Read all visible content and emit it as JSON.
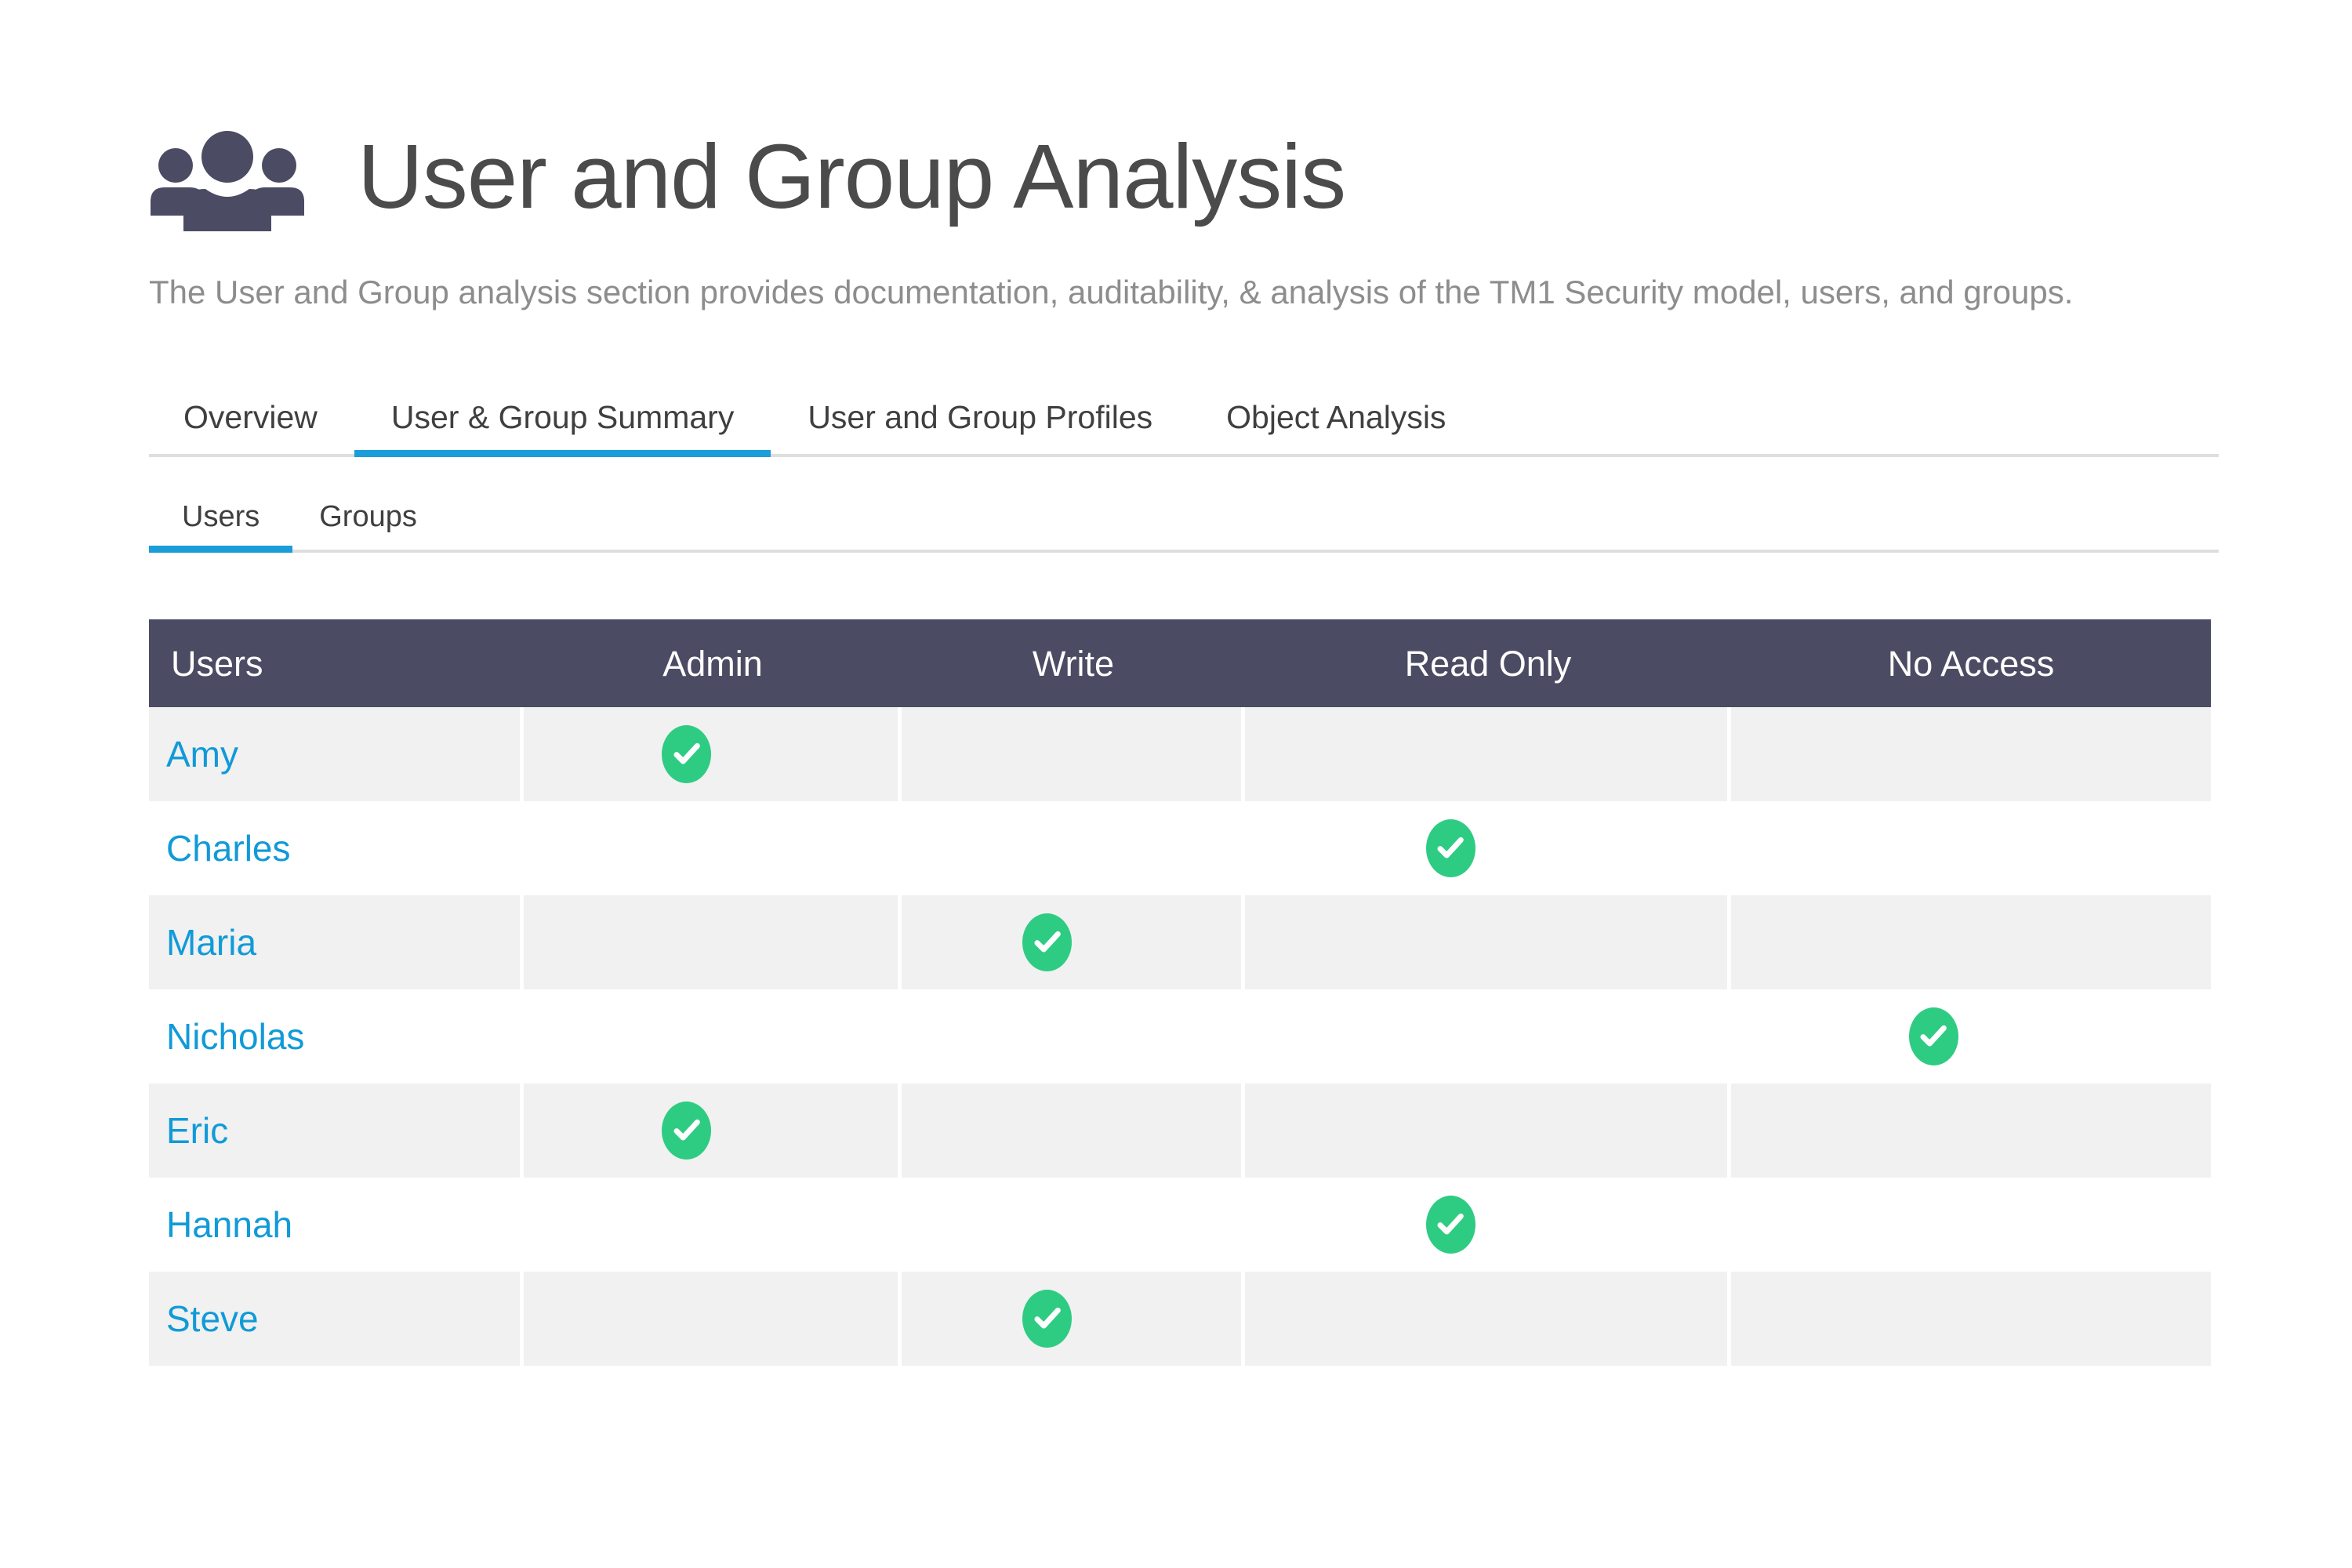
{
  "header": {
    "icon": "people-group-icon",
    "title": "User and Group Analysis",
    "subtitle": "The User and Group analysis section provides documentation, auditability, & analysis of the TM1 Security model, users, and groups."
  },
  "tabs_primary": {
    "items": [
      {
        "label": "Overview",
        "active": false
      },
      {
        "label": "User & Group Summary",
        "active": true
      },
      {
        "label": "User and Group Profiles",
        "active": false
      },
      {
        "label": "Object Analysis",
        "active": false
      }
    ]
  },
  "tabs_secondary": {
    "items": [
      {
        "label": "Users",
        "active": true
      },
      {
        "label": "Groups",
        "active": false
      }
    ]
  },
  "table": {
    "columns": [
      "Users",
      "Admin",
      "Write",
      "Read Only",
      "No Access"
    ],
    "rows": [
      {
        "name": "Amy",
        "Admin": true,
        "Write": false,
        "Read Only": false,
        "No Access": false
      },
      {
        "name": "Charles",
        "Admin": false,
        "Write": false,
        "Read Only": true,
        "No Access": false
      },
      {
        "name": "Maria",
        "Admin": false,
        "Write": true,
        "Read Only": false,
        "No Access": false
      },
      {
        "name": "Nicholas",
        "Admin": false,
        "Write": false,
        "Read Only": false,
        "No Access": true
      },
      {
        "name": "Eric",
        "Admin": true,
        "Write": false,
        "Read Only": false,
        "No Access": false
      },
      {
        "name": "Hannah",
        "Admin": false,
        "Write": false,
        "Read Only": true,
        "No Access": false
      },
      {
        "name": "Steve",
        "Admin": false,
        "Write": true,
        "Read Only": false,
        "No Access": false
      }
    ],
    "check_icon": "check-mark-icon"
  },
  "colors": {
    "header_bar": "#4b4b63",
    "accent_blue": "#1b9dd9",
    "link_blue": "#119ad8",
    "check_green": "#2ecc82",
    "row_shade": "#f1f1f1",
    "title_gray": "#4b4b4b",
    "subtitle_gray": "#8d8d8d"
  }
}
